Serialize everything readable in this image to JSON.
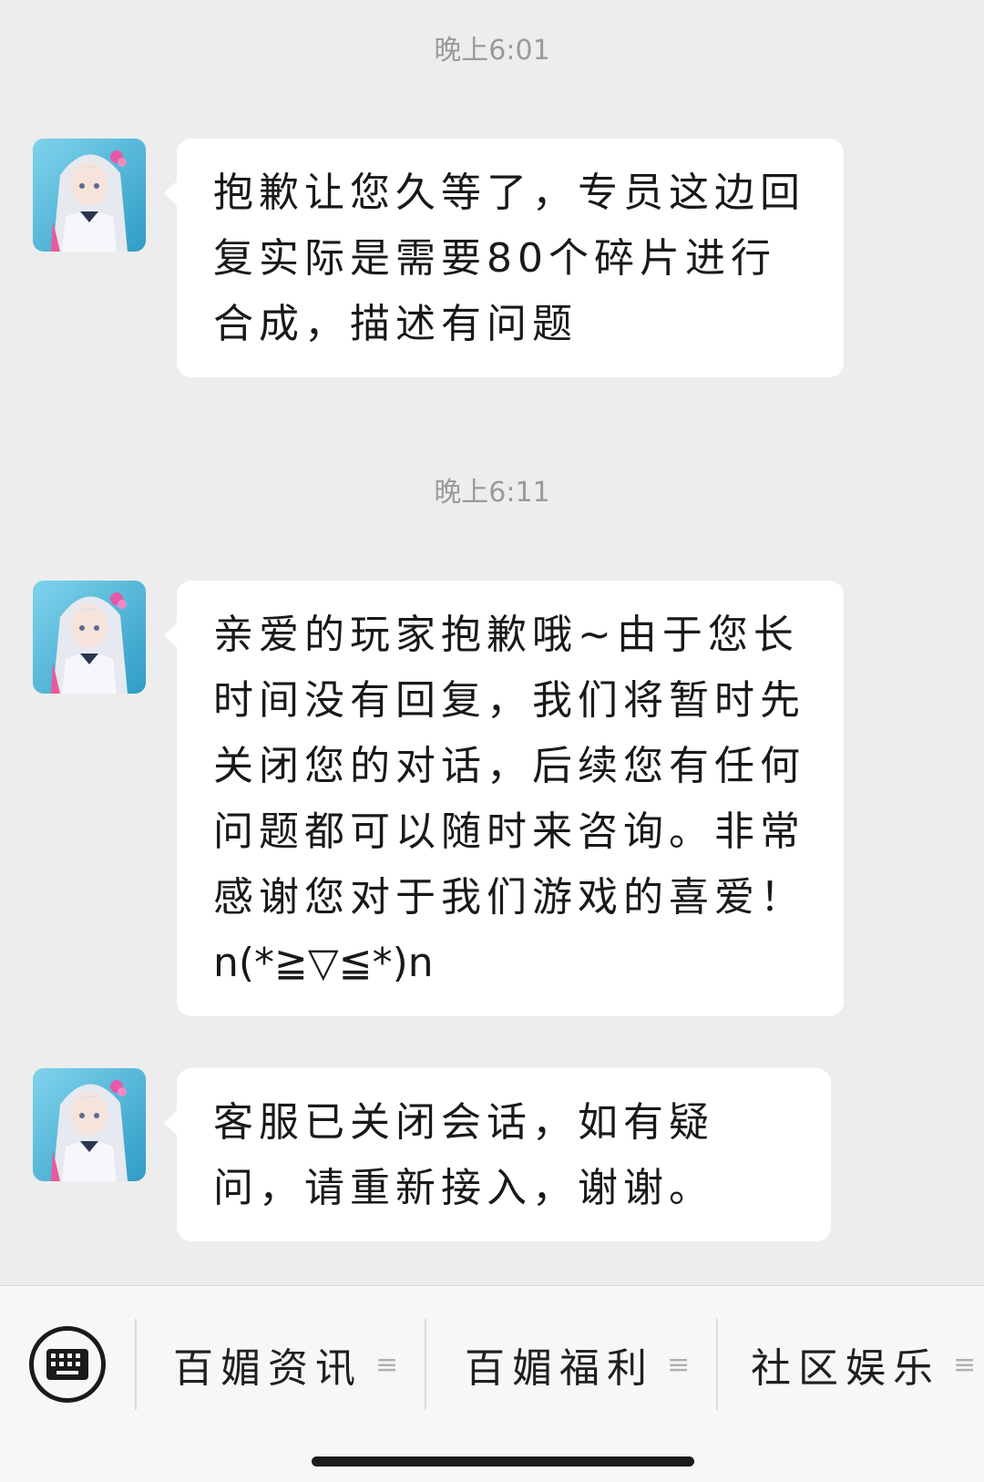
{
  "conversation": {
    "entries": [
      {
        "timestamp": "晚上6:01"
      },
      {
        "message": "抱歉让您久等了，专员这边回复实际是需要80个碎片进行合成，描述有问题"
      },
      {
        "timestamp": "晚上6:11"
      },
      {
        "message": "亲爱的玩家抱歉哦~由于您长时间没有回复，我们将暂时先关闭您的对话，后续您有任何问题都可以随时来咨询。非常感谢您对于我们游戏的喜爱！",
        "emote": "n(*≧▽≦*)n"
      },
      {
        "message": "客服已关闭会话，如有疑问，请重新接入，谢谢。"
      }
    ]
  },
  "bottom_menu": {
    "keyboard_icon": "keyboard-icon",
    "items": [
      {
        "label": "百媚资讯",
        "icon": "≡"
      },
      {
        "label": "百媚福利",
        "icon": "≡"
      },
      {
        "label": "社区娱乐",
        "icon": "≡"
      }
    ]
  },
  "colors": {
    "background": "#ededed",
    "bubble": "#ffffff",
    "timestamp_text": "#9a9a9a"
  }
}
